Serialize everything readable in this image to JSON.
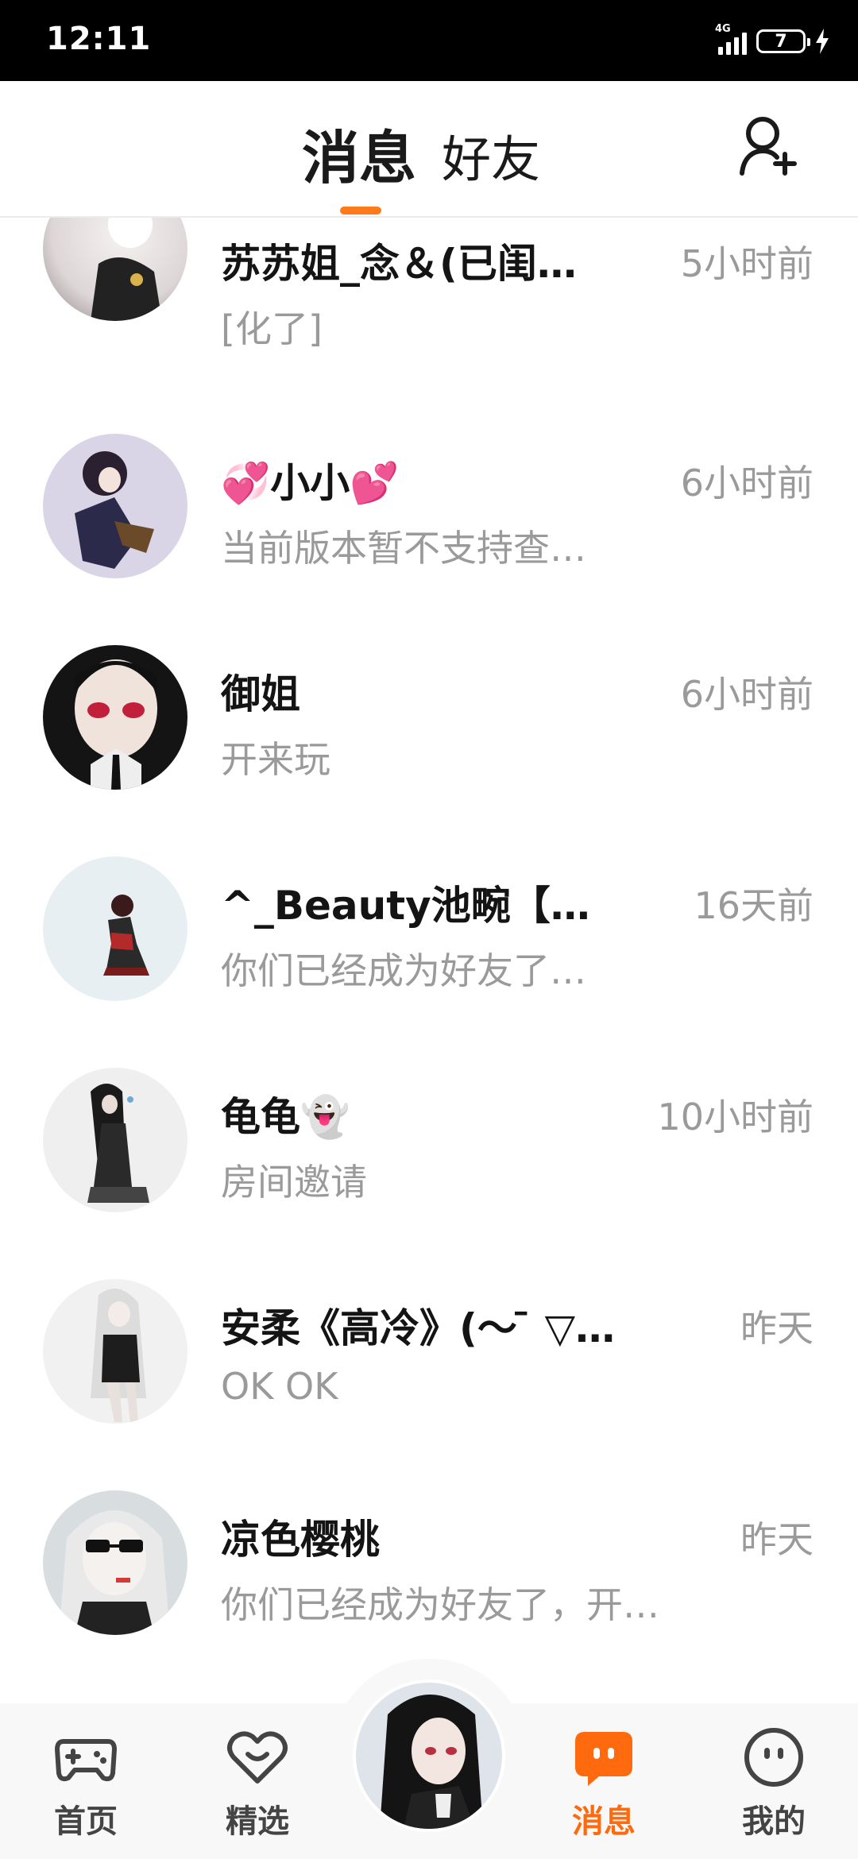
{
  "status_bar": {
    "time": "12:11",
    "network": "4G",
    "battery": "7"
  },
  "header": {
    "tab_messages": "消息",
    "tab_friends": "好友",
    "add_friend_icon": "add-friend-icon"
  },
  "conversations": [
    {
      "name": "苏苏姐_念＆(已闺…",
      "time": "5小时前",
      "preview": "[化了]"
    },
    {
      "name": "💞小小💕",
      "time": "6小时前",
      "preview": "当前版本暂不支持查…"
    },
    {
      "name": "御姐",
      "time": "6小时前",
      "preview": "开来玩"
    },
    {
      "name": "^_Beauty池畹【…",
      "time": "16天前",
      "preview": "你们已经成为好友了…"
    },
    {
      "name": "龟龟👻",
      "time": "10小时前",
      "preview": "房间邀请"
    },
    {
      "name": "安柔《高冷》(～ ̄ ▽…",
      "time": "昨天",
      "preview": "OK OK"
    },
    {
      "name": "凉色樱桃",
      "time": "昨天",
      "preview": "你们已经成为好友了，开…"
    }
  ],
  "bottom_nav": {
    "home": "首页",
    "featured": "精选",
    "messages": "消息",
    "mine": "我的"
  },
  "colors": {
    "accent": "#ff6a0e",
    "muted_text": "#9a9a9a"
  }
}
